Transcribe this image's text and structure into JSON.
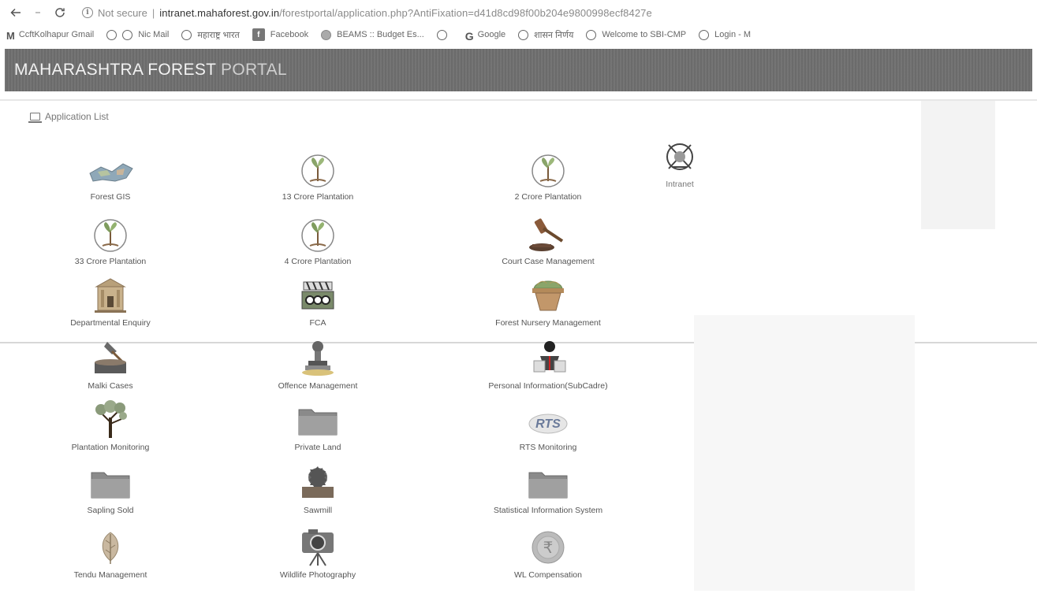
{
  "browser": {
    "security_label": "Not secure",
    "url_host": "intranet.mahaforest.gov.in",
    "url_path": "/forestportal/application.php?AntiFixation=d41d8cd98f00b204e9800998ecf8427e"
  },
  "bookmarks": [
    {
      "label": "CcftKolhapur Gmail",
      "icon": "gmail-icon"
    },
    {
      "label": "Nic Mail",
      "icon": "globe-icon"
    },
    {
      "label": "महाराष्ट्र भारत",
      "icon": "globe-icon"
    },
    {
      "label": "Facebook",
      "icon": "facebook-icon"
    },
    {
      "label": "BEAMS :: Budget Es...",
      "icon": "beams-icon"
    },
    {
      "label": "",
      "icon": "globe-icon"
    },
    {
      "label": "Google",
      "icon": "google-icon"
    },
    {
      "label": "शासन निर्णय",
      "icon": "globe-icon"
    },
    {
      "label": "Welcome to SBI-CMP",
      "icon": "globe-icon"
    },
    {
      "label": "Login - M",
      "icon": "globe-icon"
    }
  ],
  "header": {
    "title_bold": "MAHARASHTRA FOREST",
    "title_light": " PORTAL"
  },
  "section": {
    "label": "Application List"
  },
  "apps": [
    {
      "label": "Forest GIS",
      "icon": "map-icon"
    },
    {
      "label": "13 Crore Plantation",
      "icon": "sapling-icon"
    },
    {
      "label": "2 Crore Plantation",
      "icon": "sapling-icon"
    },
    {
      "label": "Intranet",
      "icon": "globe-network-icon"
    },
    {
      "label": "33 Crore Plantation",
      "icon": "sapling-icon"
    },
    {
      "label": "4 Crore Plantation",
      "icon": "sapling-icon"
    },
    {
      "label": "Court Case Management",
      "icon": "gavel-icon"
    },
    {
      "label": "Departmental Enquiry",
      "icon": "building-icon"
    },
    {
      "label": "FCA",
      "icon": "film-icon"
    },
    {
      "label": "Forest Nursery Management",
      "icon": "plant-pot-icon"
    },
    {
      "label": "Malki Cases",
      "icon": "axe-stump-icon"
    },
    {
      "label": "Offence Management",
      "icon": "stamp-icon"
    },
    {
      "label": "Personal Information(SubCadre)",
      "icon": "person-icon"
    },
    {
      "label": "Plantation Monitoring",
      "icon": "tree-icon"
    },
    {
      "label": "Private Land",
      "icon": "folder-icon"
    },
    {
      "label": "RTS Monitoring",
      "icon": "rts-icon"
    },
    {
      "label": "Sapling Sold",
      "icon": "folder-icon"
    },
    {
      "label": "Sawmill",
      "icon": "sawmill-icon"
    },
    {
      "label": "Statistical Information System",
      "icon": "folder-icon"
    },
    {
      "label": "Tendu Management",
      "icon": "leaf-icon"
    },
    {
      "label": "Wildlife Photography",
      "icon": "camera-icon"
    },
    {
      "label": "WL Compensation",
      "icon": "rupee-icon"
    }
  ]
}
